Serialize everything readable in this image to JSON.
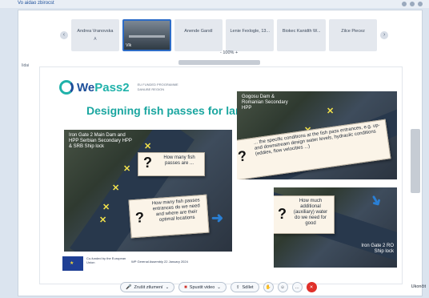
{
  "topbar": {
    "label": "Vo aidao zbirocst"
  },
  "participants": [
    {
      "name": "Andrea Vranovska",
      "sub": "A",
      "video": false
    },
    {
      "name": "",
      "sub": "",
      "video": true,
      "video_label": "Vlk"
    },
    {
      "name": "Anende Garstl",
      "sub": "",
      "video": false
    },
    {
      "name": "Lenie Fexlogle, 13...",
      "sub": "",
      "video": false
    },
    {
      "name": "Biokec Kanidth W...",
      "sub": "",
      "video": false
    },
    {
      "name": "Zilce Piecez",
      "sub": "",
      "video": false
    }
  ],
  "side_label": "Iidai",
  "zoom": {
    "label": "-  100%  +"
  },
  "slide": {
    "logo_text_a": "We",
    "logo_text_b": "Pass2",
    "logo_sub": "EU FUNDED PROGRAMME DANUBE REGION",
    "title": "Designing fish passes for large",
    "map1_label": "Iron Gate 2 Main Dam and HPP Serbian Secondary HPP & SRB Ship lock",
    "map2_label": "Gogosu Dam & Romanian Secondary HPP",
    "map3_label": "Iron Gate 2 RO Ship lock",
    "q1": "How many fish passes are ...",
    "q2": "How many fish passes entrances do we need and where are their optimal locations",
    "q3": "... the specific conditions at the fish pass entrances, e.g. up- and downstream design water levels, hydraulic conditions (eddies, flow velocities ...)",
    "q4": "How much additional (auxiliary) water do we need for good",
    "footer_eu": "Co-funded by the European Union",
    "footer_date": "WP Gerenal Assembly 22 January 2024"
  },
  "controls": {
    "mute": "Zrušit ztlumení",
    "video": "Spustit video",
    "share": "Sdílet",
    "close": "Ukončit"
  },
  "colors": {
    "accent": "#1aa6a0",
    "brand": "#1d4f9a",
    "end_call": "#e0302a"
  }
}
